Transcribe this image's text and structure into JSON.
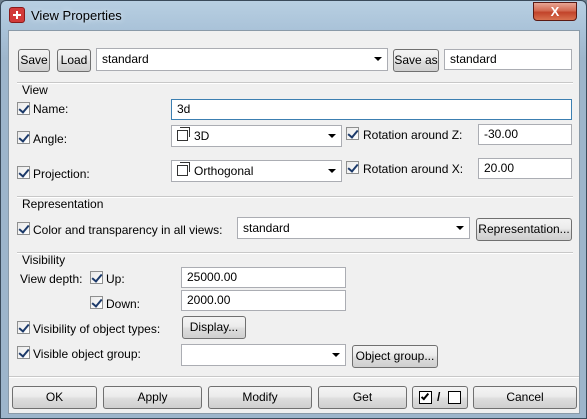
{
  "window": {
    "title": "View Properties",
    "close_glyph": "X"
  },
  "top": {
    "save_label": "Save",
    "load_label": "Load",
    "settings_value": "standard",
    "save_as_label": "Save as",
    "save_as_value": "standard"
  },
  "view": {
    "section_label": "View",
    "name_label": "Name:",
    "name_value": "3d",
    "angle_label": "Angle:",
    "angle_value": "3D",
    "rotation_z_label": "Rotation around Z:",
    "rotation_z_value": "-30.00",
    "projection_label": "Projection:",
    "projection_value": "Orthogonal",
    "rotation_x_label": "Rotation around X:",
    "rotation_x_value": "20.00"
  },
  "representation": {
    "section_label": "Representation",
    "color_label": "Color and transparency in all views:",
    "color_value": "standard",
    "button_label": "Representation..."
  },
  "visibility": {
    "section_label": "Visibility",
    "depth_label": "View depth:",
    "up_label": "Up:",
    "up_value": "25000.00",
    "down_label": "Down:",
    "down_value": "2000.00",
    "object_types_label": "Visibility of object types:",
    "display_button_label": "Display...",
    "object_group_label": "Visible object group:",
    "object_group_value": "",
    "object_group_button_label": "Object group..."
  },
  "footer": {
    "ok_label": "OK",
    "apply_label": "Apply",
    "modify_label": "Modify",
    "get_label": "Get",
    "toggle_label": "/",
    "cancel_label": "Cancel"
  }
}
